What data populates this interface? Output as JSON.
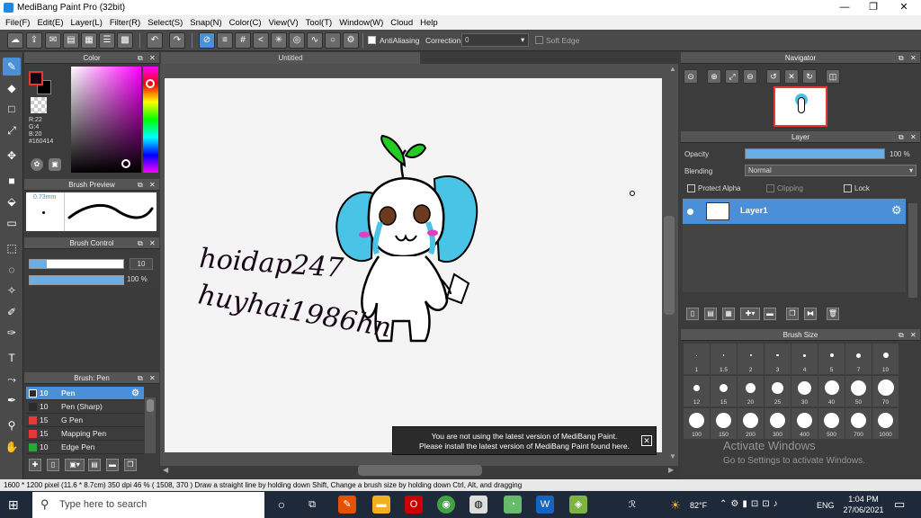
{
  "window": {
    "title": "MediBang Paint Pro (32bit)",
    "minimize": "—",
    "restore": "❐",
    "close": "✕"
  },
  "menu": [
    "File(F)",
    "Edit(E)",
    "Layer(L)",
    "Filter(R)",
    "Select(S)",
    "Snap(N)",
    "Color(C)",
    "View(V)",
    "Tool(T)",
    "Window(W)",
    "Cloud",
    "Help"
  ],
  "toolbar": {
    "antialiasing": "AntiAliasing",
    "correction_label": "Correction",
    "correction_value": "0",
    "soft_edge": "Soft Edge"
  },
  "color_panel": {
    "title": "Color",
    "r": "R:22",
    "g": "G:4",
    "b": "B:20",
    "hex": "#160414",
    "fg_color": "#160414",
    "bg_color": "#000000"
  },
  "brush_preview": {
    "title": "Brush Preview",
    "size": "0.73mm"
  },
  "brush_control": {
    "title": "Brush Control",
    "size_value": "10",
    "opacity_value": "100 %"
  },
  "brush_panel": {
    "title": "Brush: Pen",
    "items": [
      {
        "size": "10",
        "name": "Pen",
        "color": "#2a2a2a"
      },
      {
        "size": "10",
        "name": "Pen (Sharp)",
        "color": "#2a2a2a"
      },
      {
        "size": "15",
        "name": "G Pen",
        "color": "#e53935"
      },
      {
        "size": "15",
        "name": "Mapping Pen",
        "color": "#e53935"
      },
      {
        "size": "10",
        "name": "Edge Pen",
        "color": "#1faa3a"
      }
    ]
  },
  "document": {
    "tab": "Untitled"
  },
  "canvas_text": {
    "line1": "hoidap247",
    "line2": "huyhai1986hn"
  },
  "notice": {
    "line1": "You are not using the latest version of MediBang Paint.",
    "line2": "Please install the latest version of MediBang Paint found here.",
    "close": "✕"
  },
  "navigator": {
    "title": "Navigator"
  },
  "layer_panel": {
    "title": "Layer",
    "opacity_label": "Opacity",
    "opacity_value": "100 %",
    "opacity_fraction": 1.0,
    "blending_label": "Blending",
    "blending_value": "Normal",
    "protect_alpha": "Protect Alpha",
    "clipping": "Clipping",
    "lock": "Lock",
    "layer_name": "Layer1"
  },
  "brush_size": {
    "title": "Brush Size",
    "sizes": [
      "1",
      "1.5",
      "2",
      "3",
      "4",
      "5",
      "7",
      "10",
      "12",
      "15",
      "20",
      "25",
      "30",
      "40",
      "50",
      "70",
      "100",
      "150",
      "200",
      "300",
      "400",
      "500",
      "700",
      "1000"
    ]
  },
  "watermark": {
    "line1": "Activate Windows",
    "line2": "Go to Settings to activate Windows."
  },
  "statusbar": {
    "text": "1600 * 1200 pixel   (11.6 * 8.7cm)   350 dpi   46 %   ( 1508, 370 )   Draw a straight line by holding down Shift, Change a brush size by holding down Ctrl, Alt, and dragging"
  },
  "taskbar": {
    "search_placeholder": "Type here to search",
    "weather": "82°F",
    "lang": "ENG",
    "time": "1:04 PM",
    "date": "27/06/2021"
  }
}
